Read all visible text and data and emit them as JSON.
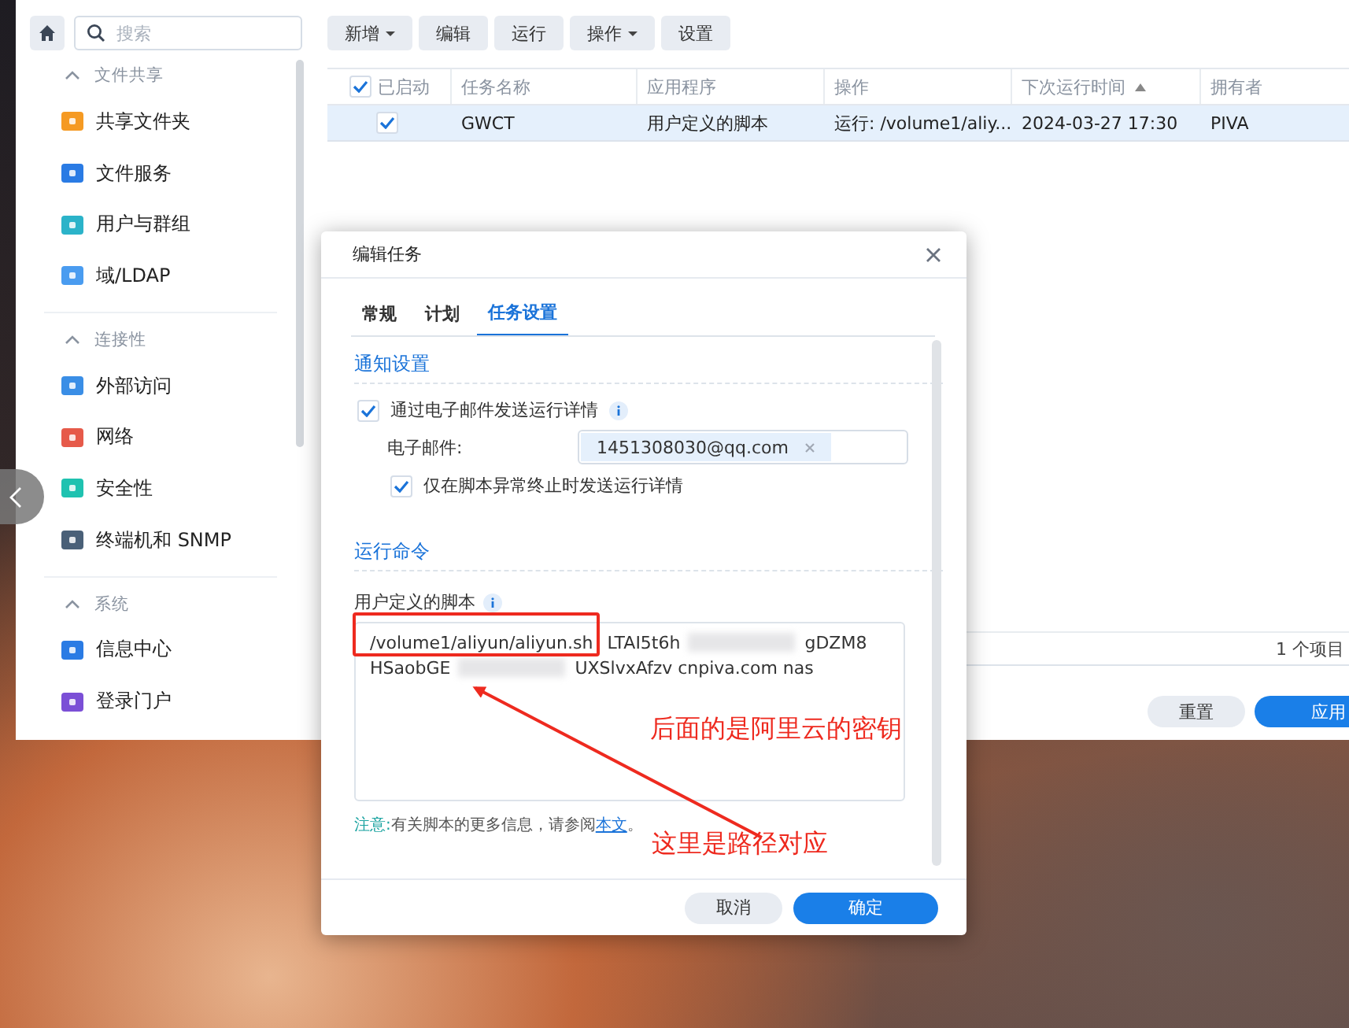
{
  "sidebar": {
    "search": {
      "placeholder": "搜索"
    },
    "sections": [
      {
        "title": "文件共享",
        "expanded": true,
        "items": [
          {
            "label": "共享文件夹"
          },
          {
            "label": "文件服务"
          },
          {
            "label": "用户与群组"
          },
          {
            "label": "域/LDAP"
          }
        ]
      },
      {
        "title": "连接性",
        "expanded": true,
        "items": [
          {
            "label": "外部访问"
          },
          {
            "label": "网络"
          },
          {
            "label": "安全性"
          },
          {
            "label": "终端机和 SNMP"
          }
        ]
      },
      {
        "title": "系统",
        "expanded": true,
        "items": [
          {
            "label": "信息中心"
          },
          {
            "label": "登录门户"
          }
        ]
      }
    ]
  },
  "toolbar": [
    {
      "label": "新增",
      "menu": true
    },
    {
      "label": "编辑",
      "menu": false
    },
    {
      "label": "运行",
      "menu": false
    },
    {
      "label": "操作",
      "menu": true
    },
    {
      "label": "设置",
      "menu": false
    }
  ],
  "table": {
    "all_checked": true,
    "columns": [
      {
        "label": "已启动",
        "sorted": false
      },
      {
        "label": "任务名称",
        "sorted": false
      },
      {
        "label": "应用程序",
        "sorted": false
      },
      {
        "label": "操作",
        "sorted": false
      },
      {
        "label": "下次运行时间",
        "sorted": true
      },
      {
        "label": "拥有者",
        "sorted": false
      }
    ],
    "rows": [
      {
        "enabled": true,
        "selected": true,
        "cells": [
          "",
          "GWCT",
          "用户定义的脚本",
          "运行: /volume1/aliy...",
          "2024-03-27 17:30",
          "PIVA"
        ]
      }
    ]
  },
  "status_bar": "1 个项目",
  "footer_buttons": [
    {
      "label": "重置",
      "kind": "secondary"
    },
    {
      "label": "应用",
      "kind": "primary"
    }
  ],
  "dialog": {
    "title": "编辑任务",
    "tabs": [
      {
        "label": "常规",
        "selected": false
      },
      {
        "label": "计划",
        "selected": false
      },
      {
        "label": "任务设置",
        "selected": true
      }
    ],
    "notify": {
      "title": "通知设置",
      "send_email": {
        "label": "通过电子邮件发送运行详情",
        "checked": true
      },
      "email": {
        "label": "电子邮件:",
        "chips": [
          "1451308030@qq.com"
        ]
      },
      "only_abnormal": {
        "label": "仅在脚本异常终止时发送运行详情",
        "checked": true
      }
    },
    "command": {
      "title": "运行命令",
      "script_label": "用户定义的脚本",
      "script_lines": [
        [
          {
            "text": "/volume1/aliyun/aliyun.sh",
            "blur_before": false
          },
          {
            "text": "LTAI5t6h",
            "blur_before": false
          },
          {
            "text": "gDZM8",
            "blur_before": true
          }
        ],
        [
          {
            "text": "HSaobGE",
            "blur_before": false
          },
          {
            "text": "UXSlvxAfzv cnpiva.com nas",
            "blur_before": true
          }
        ]
      ]
    },
    "note": {
      "prefix": "注意:",
      "text": "有关脚本的更多信息，请参阅",
      "link": "本文",
      "end": "。"
    },
    "buttons": [
      {
        "label": "取消",
        "kind": "secondary"
      },
      {
        "label": "确定",
        "kind": "primary"
      }
    ]
  },
  "annotations": [
    {
      "text": "后面的是阿里云的密钥"
    },
    {
      "text": "这里是路径对应"
    }
  ]
}
